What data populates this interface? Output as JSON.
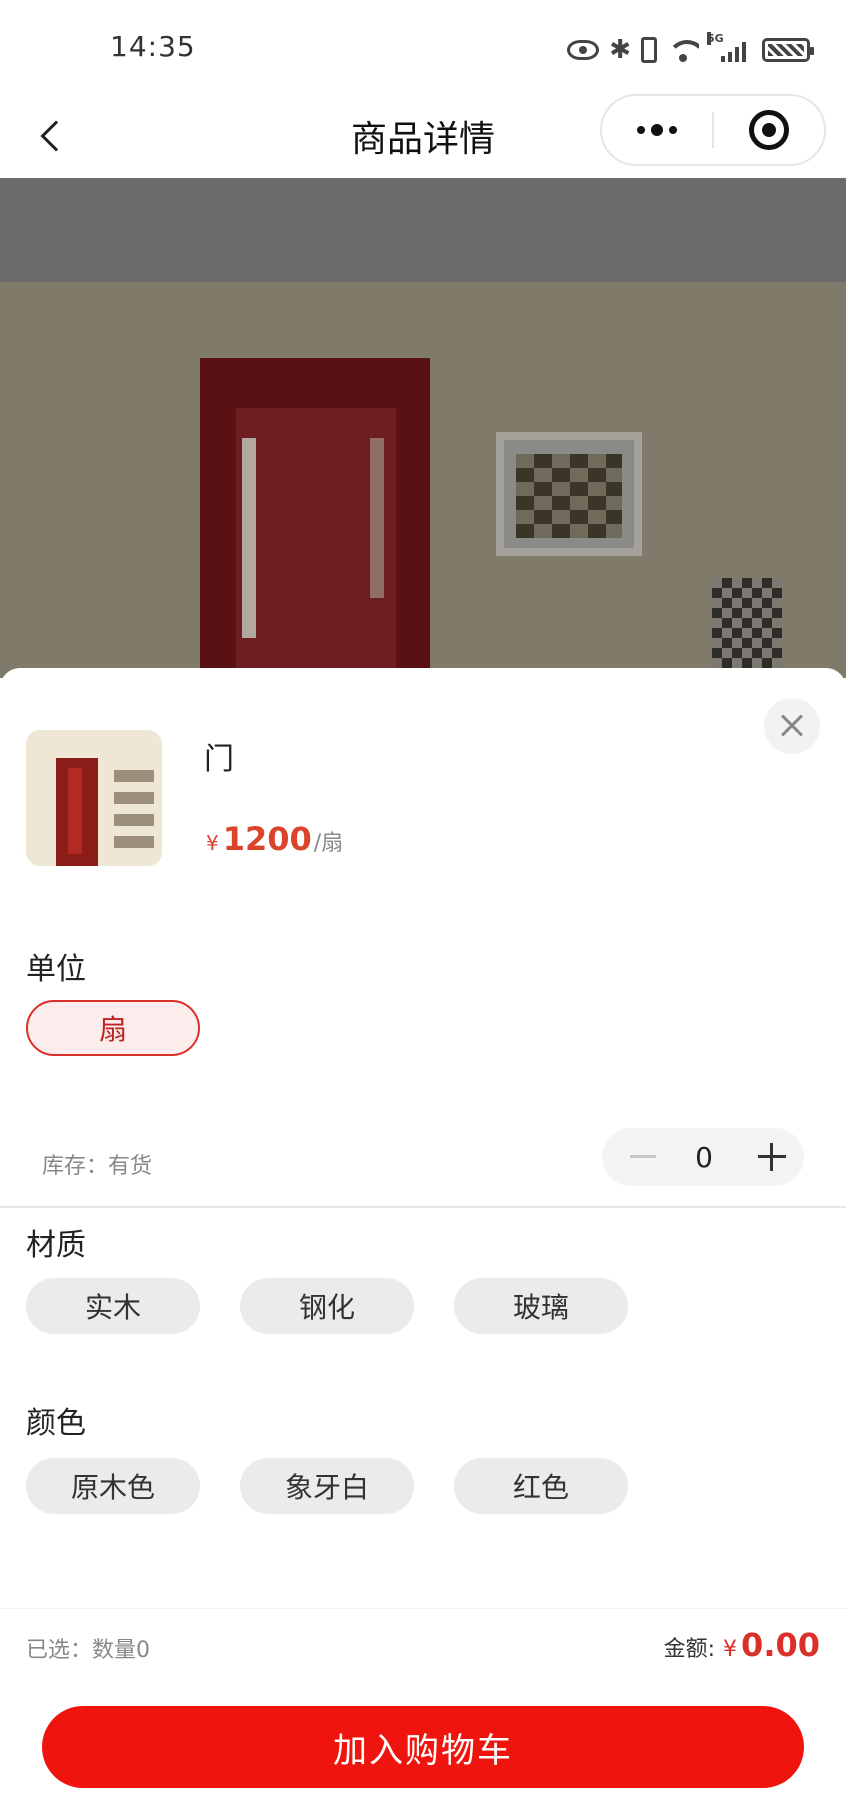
{
  "status_bar": {
    "time": "14:35",
    "network": "5G",
    "icons": [
      "eye-icon",
      "bluetooth-icon",
      "vibrate-icon",
      "wifi-icon",
      "signal-icon",
      "battery-icon"
    ]
  },
  "nav": {
    "title": "商品详情",
    "back_icon": "chevron-left-icon",
    "more_icon": "more-dots-icon",
    "close_icon": "target-circle-icon"
  },
  "product": {
    "name": "门",
    "currency": "¥",
    "price": "1200",
    "price_unit": "/扇"
  },
  "unit_section": {
    "label": "单位",
    "options": [
      {
        "label": "扇",
        "selected": true
      }
    ]
  },
  "stock": {
    "text": "库存：有货",
    "quantity": "0"
  },
  "material_section": {
    "label": "材质",
    "options": [
      {
        "label": "实木",
        "selected": false
      },
      {
        "label": "钢化",
        "selected": false
      },
      {
        "label": "玻璃",
        "selected": false
      }
    ]
  },
  "color_section": {
    "label": "颜色",
    "options": [
      {
        "label": "原木色",
        "selected": false
      },
      {
        "label": "象牙白",
        "selected": false
      },
      {
        "label": "红色",
        "selected": false
      }
    ]
  },
  "footer": {
    "selected_summary": "已选：数量0",
    "amount_label": "金额:",
    "amount_currency": "¥",
    "amount_value": "0.00",
    "add_to_cart_label": "加入购物车"
  },
  "colors": {
    "accent": "#f0140e",
    "price": "#d9442b",
    "selected_border": "#d9302a"
  }
}
